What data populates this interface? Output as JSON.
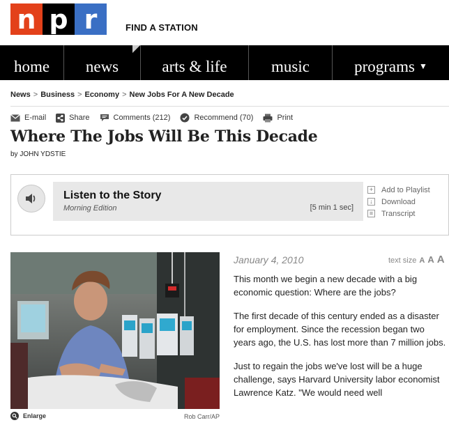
{
  "logo": {
    "letters": [
      "n",
      "p",
      "r"
    ]
  },
  "header": {
    "find_station": "FIND A STATION"
  },
  "nav": {
    "items": [
      {
        "label": "home",
        "width": 92
      },
      {
        "label": "news",
        "width": 110
      },
      {
        "label": "arts & life",
        "width": 155
      },
      {
        "label": "music",
        "width": 120
      },
      {
        "label": "programs",
        "width": 167
      }
    ]
  },
  "breadcrumb": [
    "News",
    "Business",
    "Economy",
    "New Jobs For A New Decade"
  ],
  "tools": {
    "email": "E-mail",
    "share": "Share",
    "comments": "Comments (212)",
    "recommend": "Recommend (70)",
    "print": "Print"
  },
  "article": {
    "headline": "Where The Jobs Will Be This Decade",
    "byline": "by JOHN YDSTIE",
    "date": "January 4, 2010",
    "textsize_label": "text size",
    "textsize_options": [
      "A",
      "A",
      "A"
    ],
    "paragraphs": [
      "This month we begin a new decade with a big economic question: Where are the jobs?",
      "The first decade of this century ended as a disaster for employment. Since the recession began two years ago, the U.S. has lost more than 7 million jobs.",
      "Just to regain the jobs we've lost will be a huge challenge, says Harvard University labor economist Lawrence Katz. \"We would need well"
    ]
  },
  "audio": {
    "title": "Listen to the Story",
    "program": "Morning Edition",
    "duration": "[5 min 1 sec]",
    "actions": [
      "Add to Playlist",
      "Download",
      "Transcript"
    ]
  },
  "photo": {
    "enlarge": "Enlarge",
    "credit": "Rob Carr/AP"
  },
  "colors": {
    "npr_red": "#e3411a",
    "npr_black": "#000000",
    "npr_blue": "#3a6fc4",
    "nav_bg": "#000000"
  }
}
